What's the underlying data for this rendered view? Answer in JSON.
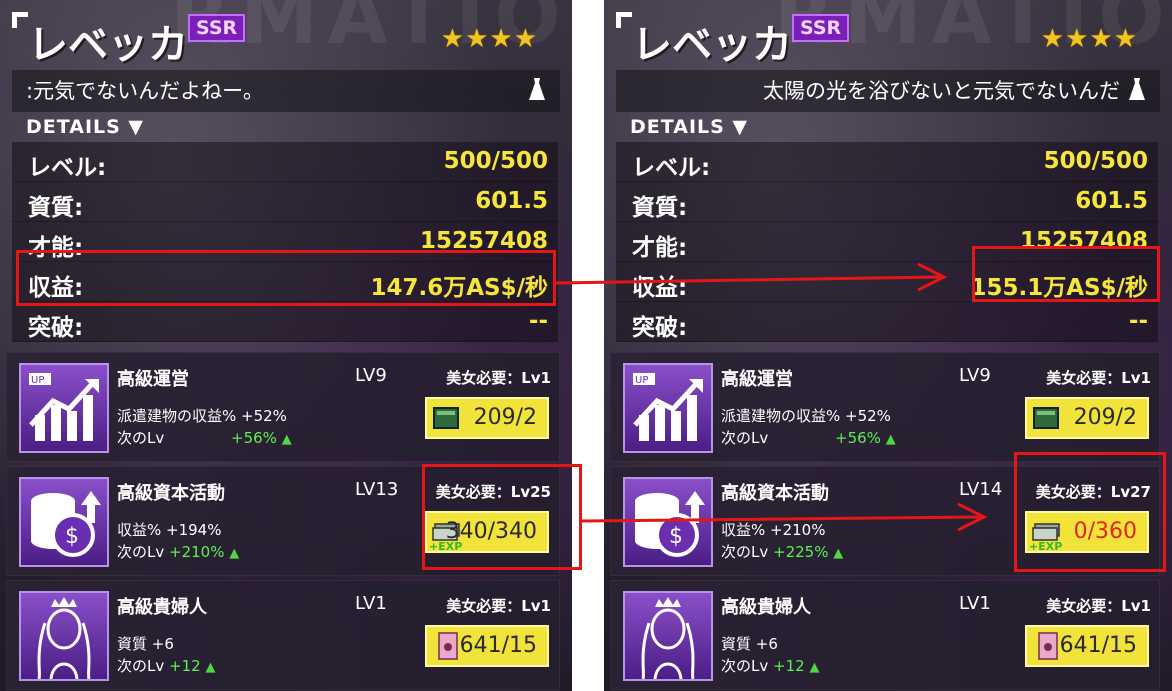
{
  "panels": [
    {
      "name": "レベッカ",
      "rarity": "SSR",
      "stars": "★★★★",
      "quote": ":元気でないんだよねー。",
      "details_label": "DETAILS ▼",
      "stats": [
        {
          "label": "レベル:",
          "value": "500/500"
        },
        {
          "label": "資質:",
          "value": "601.5"
        },
        {
          "label": "才能:",
          "value": "15257408"
        },
        {
          "label": "収益:",
          "value": "147.6万AS$/秒"
        },
        {
          "label": "突破:",
          "value": "--"
        }
      ],
      "skills": [
        {
          "title": "高級運営",
          "lv": "LV9",
          "req": "美女必要：Lv1",
          "line1": "派遣建物の収益% +52%",
          "line2_label": "次のLv",
          "line2_value": "+56%",
          "cost": "209/2",
          "cost_icon": "book-icon"
        },
        {
          "title": "高級資本活動",
          "lv": "LV13",
          "req": "美女必要：Lv25",
          "line1": "収益%  +194%",
          "line2_label": "次のLv",
          "line2_value": "+210%",
          "cost": "340/340",
          "cost_icon": "cash-exp-icon",
          "exp": "+EXP"
        },
        {
          "title": "高級貴婦人",
          "lv": "LV1",
          "req": "美女必要：Lv1",
          "line1": "資質    +6",
          "line2_label": "次のLv",
          "line2_value": "+12",
          "cost": "641/15",
          "cost_icon": "card-icon"
        }
      ]
    },
    {
      "name": "レベッカ",
      "rarity": "SSR",
      "stars": "★★★★",
      "quote": "太陽の光を浴びないと元気でないんだ",
      "details_label": "DETAILS ▼",
      "stats": [
        {
          "label": "レベル:",
          "value": "500/500"
        },
        {
          "label": "資質:",
          "value": "601.5"
        },
        {
          "label": "才能:",
          "value": "15257408"
        },
        {
          "label": "収益:",
          "value": "155.1万AS$/秒"
        },
        {
          "label": "突破:",
          "value": "--"
        }
      ],
      "skills": [
        {
          "title": "高級運営",
          "lv": "LV9",
          "req": "美女必要：Lv1",
          "line1": "派遣建物の収益% +52%",
          "line2_label": "次のLv",
          "line2_value": "+56%",
          "cost": "209/2",
          "cost_icon": "book-icon"
        },
        {
          "title": "高級資本活動",
          "lv": "LV14",
          "req": "美女必要：Lv27",
          "line1": "収益%  +210%",
          "line2_label": "次のLv",
          "line2_value": "+225%",
          "cost": "0/360",
          "cost_icon": "cash-exp-icon",
          "exp": "+EXP"
        },
        {
          "title": "高級貴婦人",
          "lv": "LV1",
          "req": "美女必要：Lv1",
          "line1": "資質    +6",
          "line2_label": "次のLv",
          "line2_value": "+12",
          "cost": "641/15",
          "cost_icon": "card-icon"
        }
      ]
    }
  ],
  "colors": {
    "accent": "#e51616",
    "value_yellow": "#f6e53a",
    "rarity_purple": "#7a1fb8"
  }
}
